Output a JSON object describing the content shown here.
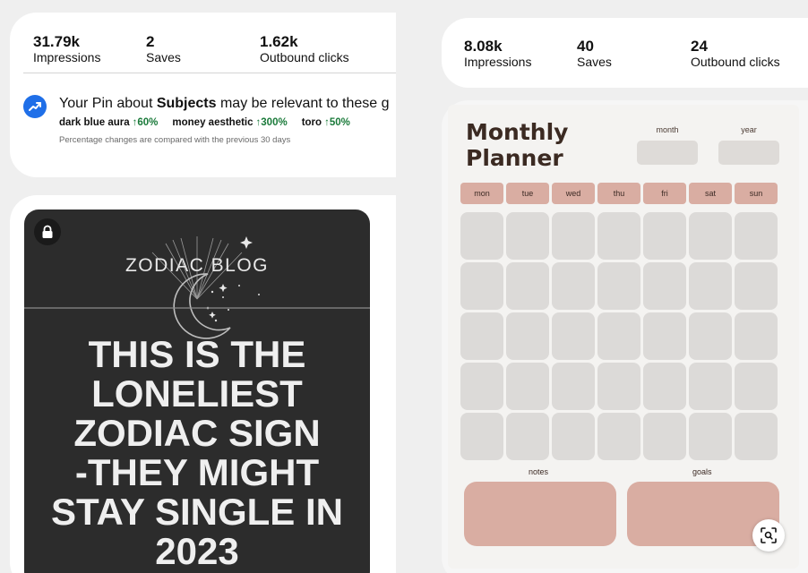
{
  "left": {
    "stats": [
      {
        "value": "31.79k",
        "label": "Impressions"
      },
      {
        "value": "2",
        "label": "Saves"
      },
      {
        "value": "1.62k",
        "label": "Outbound clicks"
      }
    ],
    "relevance": {
      "prefix": "Your Pin about ",
      "subject": "Subjects",
      "suffix": " may be relevant to these g",
      "topics": [
        {
          "name": "dark blue aura",
          "change": "↑60%"
        },
        {
          "name": "money aesthetic",
          "change": "↑300%"
        },
        {
          "name": "toro",
          "change": "↑50%"
        }
      ],
      "footnote": "Percentage changes are compared with the previous 30 days"
    },
    "pin": {
      "blog_title": "ZODIAC BLOG",
      "headline_lines": [
        "THIS IS THE",
        "LONELIEST",
        "ZODIAC SIGN",
        "-THEY MIGHT",
        "STAY SINGLE IN",
        "2023"
      ]
    }
  },
  "right": {
    "stats": [
      {
        "value": "8.08k",
        "label": "Impressions"
      },
      {
        "value": "40",
        "label": "Saves"
      },
      {
        "value": "24",
        "label": "Outbound clicks"
      }
    ],
    "planner": {
      "title_line1": "Monthly",
      "title_line2": "Planner",
      "month_label": "month",
      "year_label": "year",
      "days": [
        "mon",
        "tue",
        "wed",
        "thu",
        "fri",
        "sat",
        "sun"
      ],
      "notes_label": "notes",
      "goals_label": "goals"
    }
  },
  "icons": {
    "trend": "trending-up-icon",
    "lock": "lock-icon",
    "lens": "visual-search-icon"
  },
  "colors": {
    "accent_blue": "#1f6fe8",
    "positive_green": "#1a7a3a",
    "planner_pink": "#d9ada2",
    "planner_grey": "#dcdad8"
  }
}
